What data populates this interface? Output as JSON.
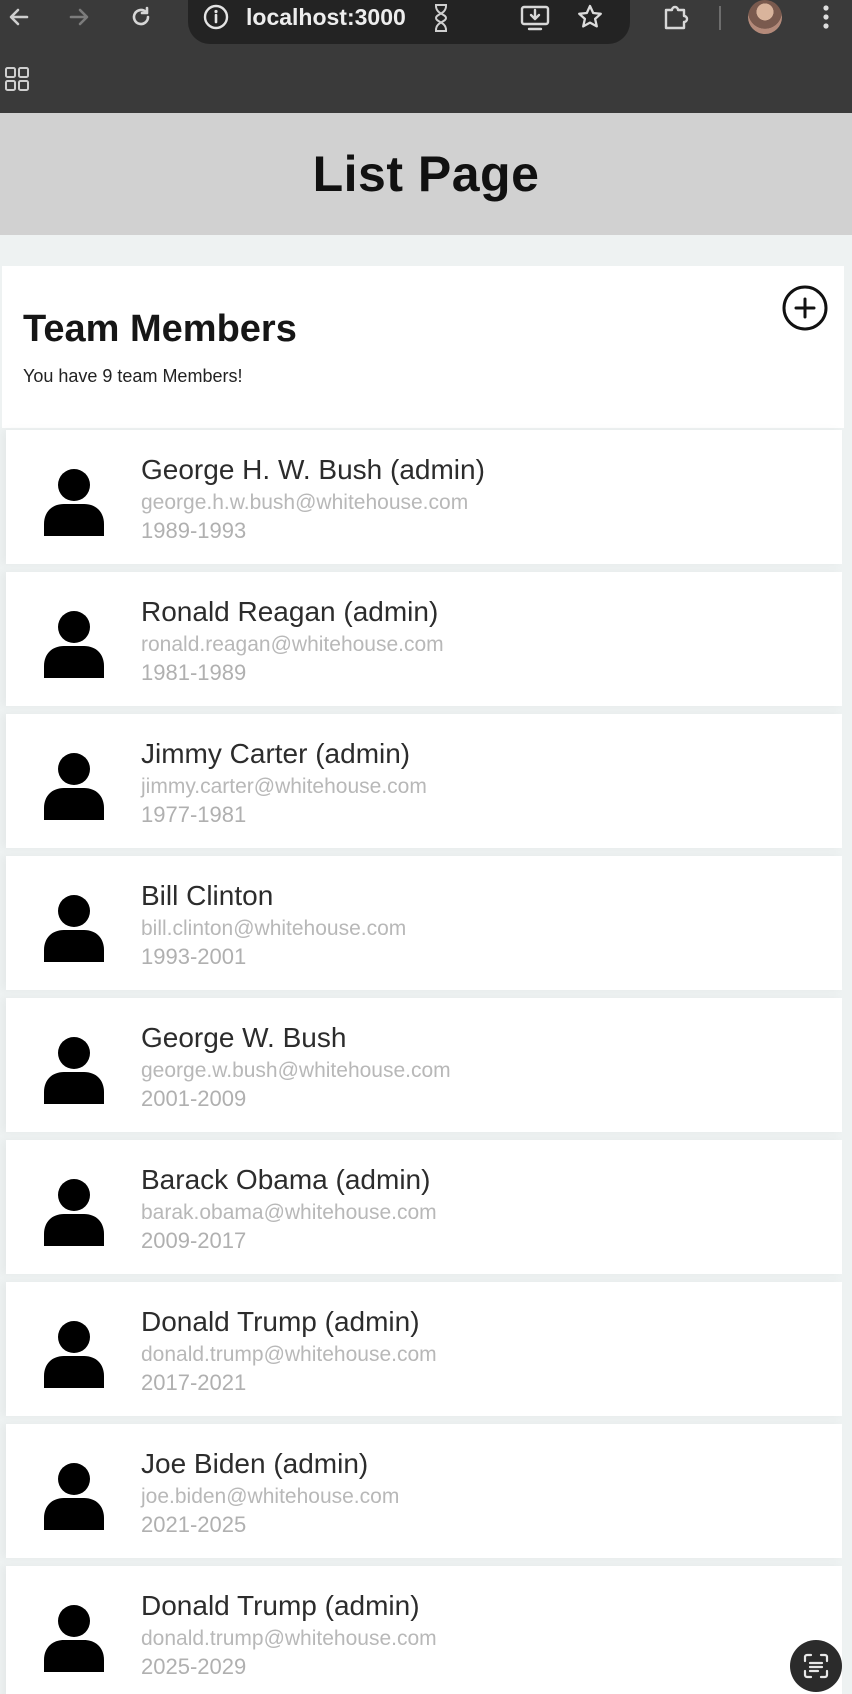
{
  "browser": {
    "url": "localhost:3000"
  },
  "header": {
    "title": "List Page"
  },
  "team": {
    "title": "Team Members",
    "subtitle": "You have 9 team Members!"
  },
  "members": [
    {
      "name": "George H. W. Bush (admin)",
      "email": "george.h.w.bush@whitehouse.com",
      "years": "1989-1993"
    },
    {
      "name": "Ronald Reagan (admin)",
      "email": "ronald.reagan@whitehouse.com",
      "years": "1981-1989"
    },
    {
      "name": "Jimmy Carter (admin)",
      "email": "jimmy.carter@whitehouse.com",
      "years": "1977-1981"
    },
    {
      "name": "Bill Clinton",
      "email": "bill.clinton@whitehouse.com",
      "years": "1993-2001"
    },
    {
      "name": "George W. Bush",
      "email": "george.w.bush@whitehouse.com",
      "years": "2001-2009"
    },
    {
      "name": "Barack Obama (admin)",
      "email": "barak.obama@whitehouse.com",
      "years": "2009-2017"
    },
    {
      "name": "Donald Trump (admin)",
      "email": "donald.trump@whitehouse.com",
      "years": "2017-2021"
    },
    {
      "name": "Joe Biden (admin)",
      "email": "joe.biden@whitehouse.com",
      "years": "2021-2025"
    },
    {
      "name": "Donald Trump (admin)",
      "email": "donald.trump@whitehouse.com",
      "years": "2025-2029"
    }
  ],
  "icons": {
    "back": "arrow-left-icon",
    "forward": "arrow-right-icon",
    "reload": "reload-icon",
    "site_info": "site-info-icon",
    "install": "install-app-icon",
    "bookmark": "star-icon",
    "extensions": "puzzle-icon",
    "menu": "kebab-menu-icon",
    "apps": "apps-grid-icon",
    "add": "plus-circle-icon",
    "person": "person-icon",
    "lens": "google-lens-icon"
  },
  "colors": {
    "chrome": "#3a3a3a",
    "header_bg": "#d1d1d1",
    "page_bg": "#eef2f2",
    "card_bg": "#ffffff",
    "secondary_text": "#b8b8b8"
  }
}
